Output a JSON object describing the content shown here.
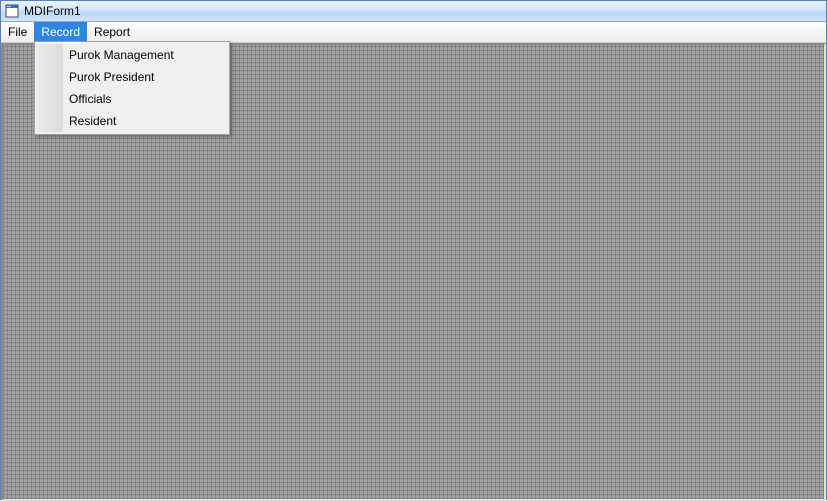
{
  "window": {
    "title": "MDIForm1"
  },
  "menubar": {
    "items": [
      {
        "label": "File"
      },
      {
        "label": "Record"
      },
      {
        "label": "Report"
      }
    ],
    "active_index": 1
  },
  "dropdown": {
    "items": [
      {
        "label": "Purok Management"
      },
      {
        "label": "Purok President"
      },
      {
        "label": "Officials"
      },
      {
        "label": "Resident"
      }
    ]
  }
}
